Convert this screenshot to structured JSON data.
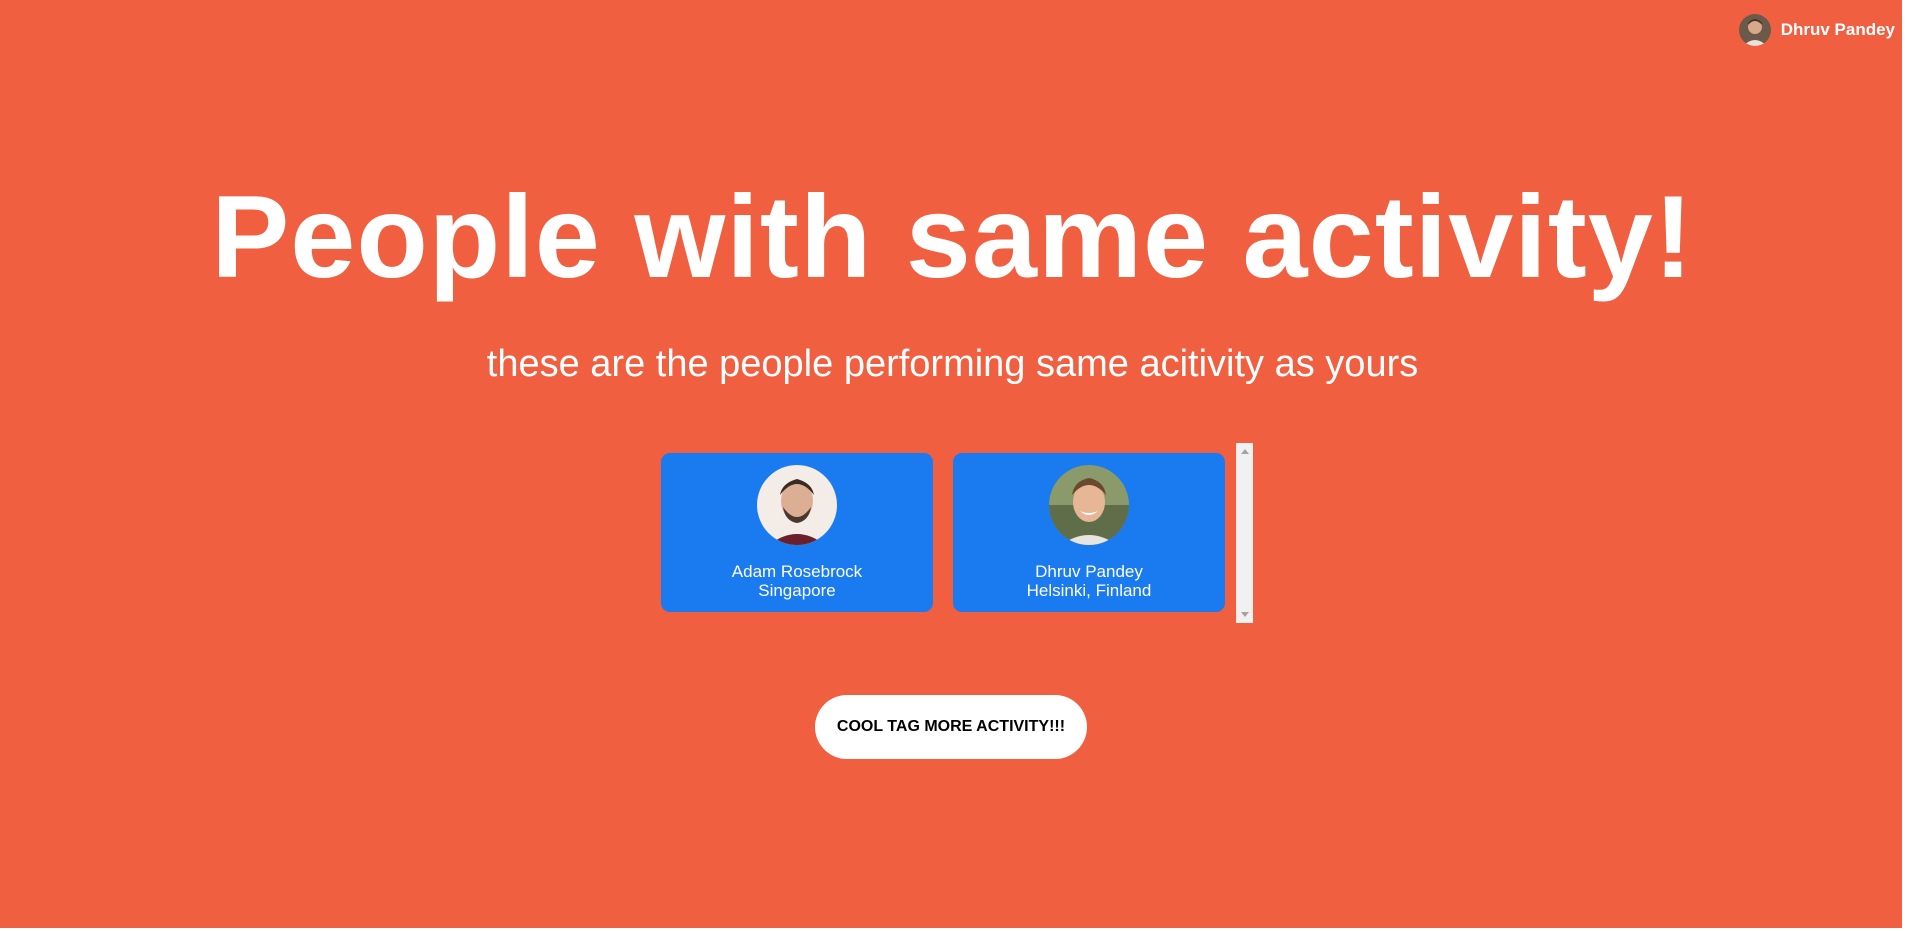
{
  "header": {
    "user_name": "Dhruv Pandey",
    "avatar_icon": "user-avatar"
  },
  "hero": {
    "title": "People with same activity!",
    "subtitle": "these are the people performing same acitivity as yours"
  },
  "people": [
    {
      "name": "Adam Rosebrock",
      "location": "Singapore"
    },
    {
      "name": "Dhruv Pandey",
      "location": "Helsinki, Finland"
    }
  ],
  "cta": {
    "label": "COOL TAG MORE ACTIVITY!!!"
  },
  "colors": {
    "background": "#f15f41",
    "card": "#1a7af0",
    "text": "#ffffff",
    "button_bg": "#ffffff",
    "button_text": "#000000"
  }
}
